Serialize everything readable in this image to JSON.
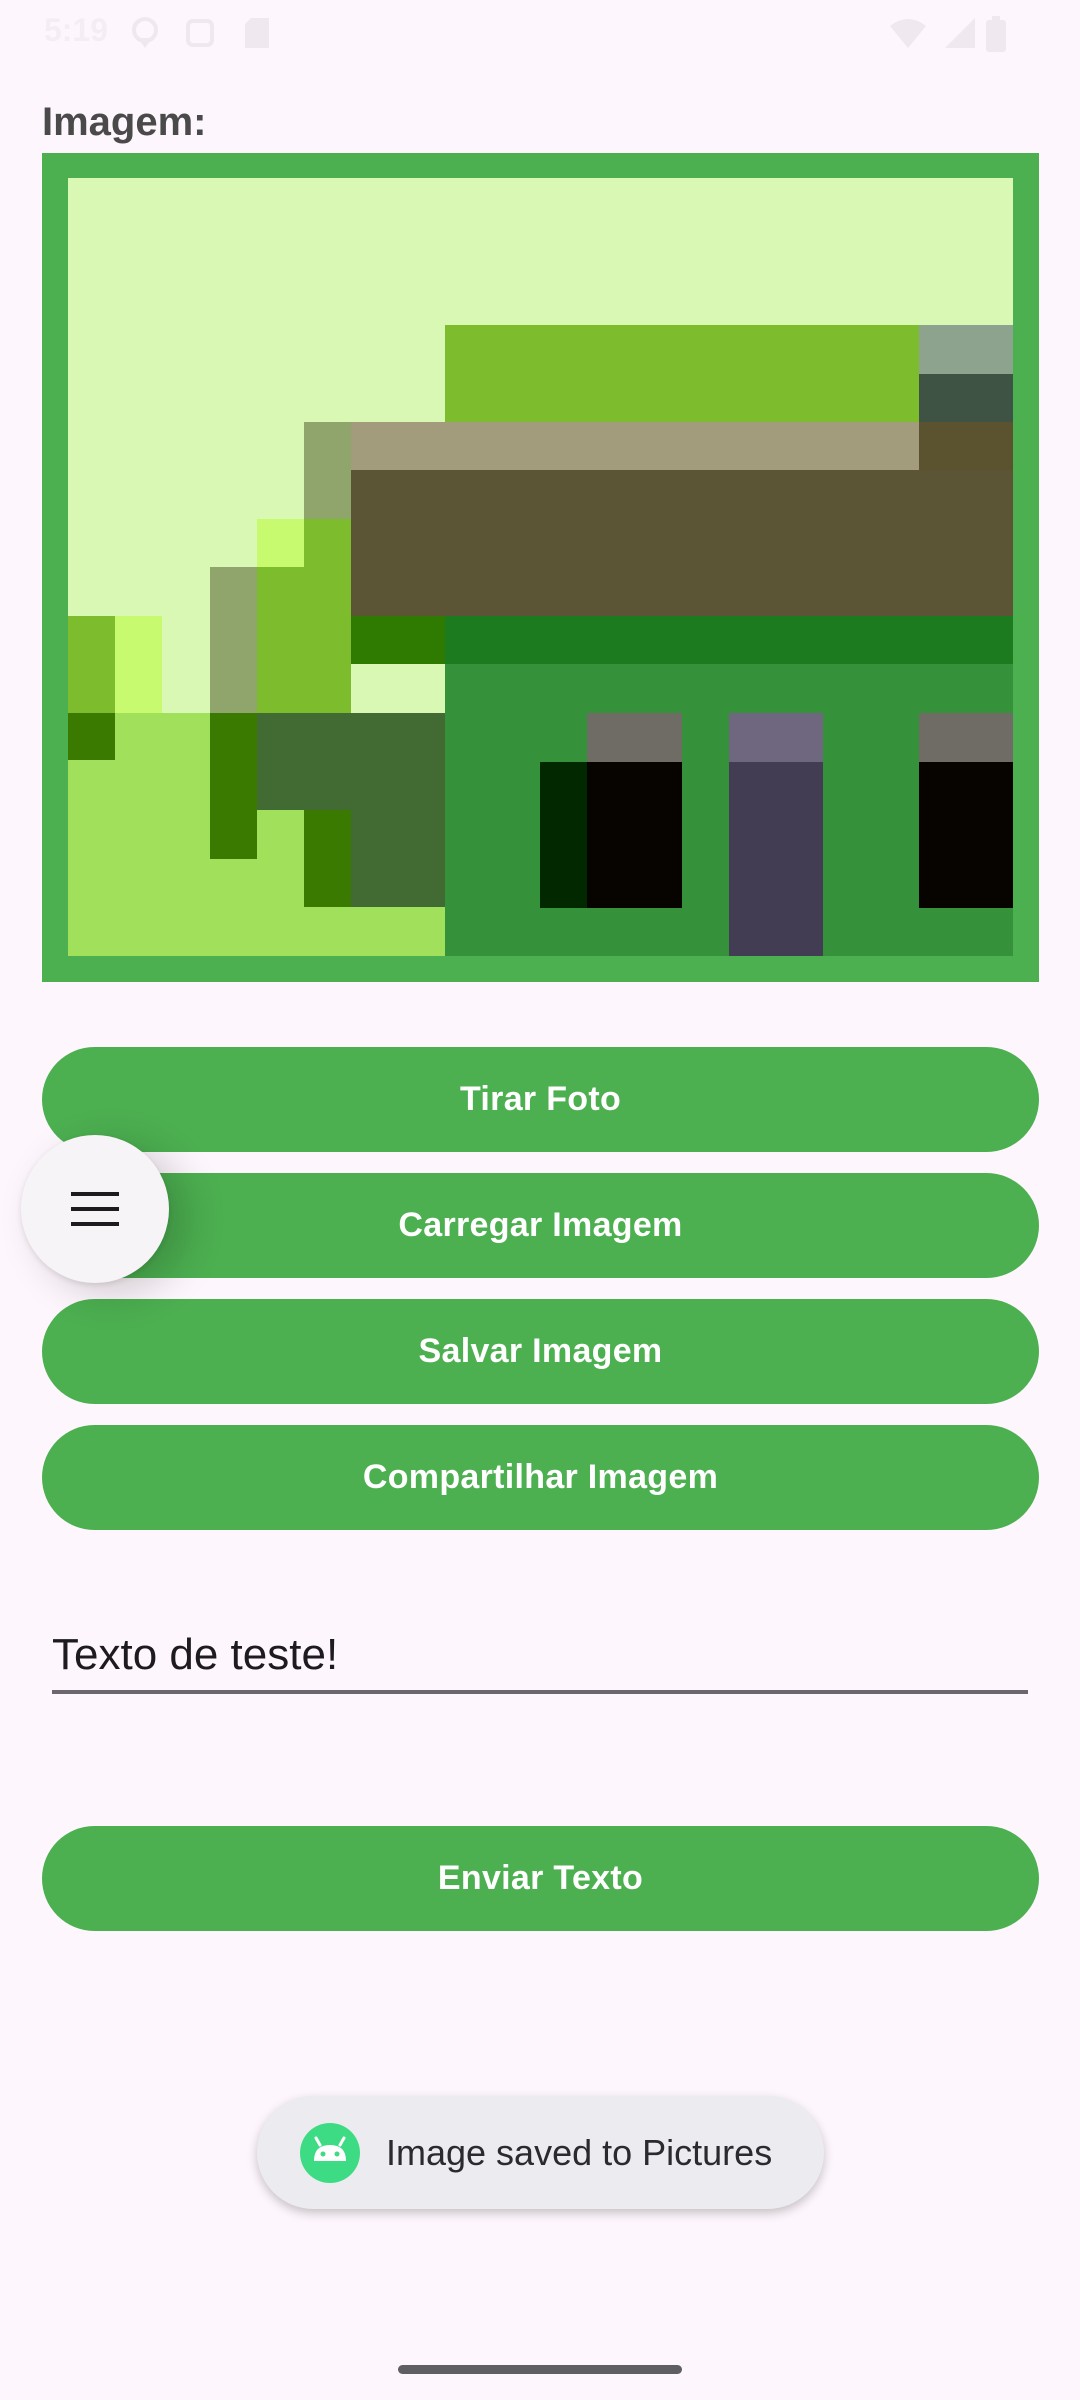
{
  "status_bar": {
    "time": "5:19",
    "icons": [
      "location-icon",
      "notification-icon",
      "sd-card-icon",
      "wifi-icon",
      "signal-icon",
      "battery-icon"
    ]
  },
  "image_section": {
    "label": "Imagem:",
    "frame_color": "#4caf50"
  },
  "buttons": {
    "take_photo": "Tirar Foto",
    "load_image": "Carregar Imagem",
    "save_image": "Salvar Imagem",
    "share_image": "Compartilhar Imagem",
    "send_text": "Enviar Texto"
  },
  "fab": {
    "icon": "menu-icon"
  },
  "text_field": {
    "value": "Texto de teste!"
  },
  "toast": {
    "icon": "android-icon",
    "message": "Image saved to Pictures"
  },
  "colors": {
    "accent": "#4caf50",
    "background": "#fdf6fc"
  }
}
